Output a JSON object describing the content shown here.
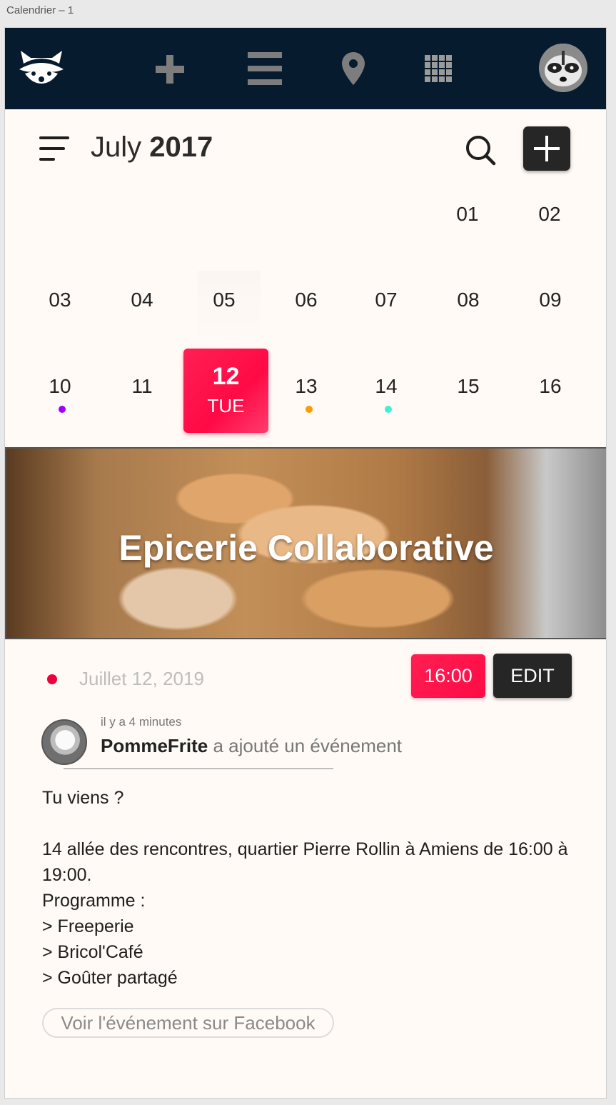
{
  "window": {
    "title": "Calendrier – 1"
  },
  "nav": {
    "icons": [
      "raccoon-logo",
      "plus-icon",
      "list-icon",
      "map-pin-icon",
      "grid-icon",
      "user-avatar"
    ]
  },
  "calendar": {
    "month": "July",
    "year": "2017",
    "weeks": [
      [
        "",
        "",
        "",
        "",
        "",
        "01",
        "02"
      ],
      [
        "03",
        "04",
        "05",
        "06",
        "07",
        "08",
        "09"
      ],
      [
        "10",
        "11",
        "12",
        "13",
        "14",
        "15",
        "16"
      ]
    ],
    "selected": {
      "day": "12",
      "weekday": "TUE"
    },
    "event_dots": {
      "10": "#a100ff",
      "13": "#ff9a00",
      "14": "#3ff0d6"
    }
  },
  "event": {
    "title": "Epicerie Collaborative",
    "date": "Juillet 12, 2019",
    "time": "16:00",
    "edit_label": "EDIT",
    "time_ago": "il y a 4 minutes",
    "user": "PommeFrite",
    "action": "a ajouté un événement",
    "description": "Tu viens ?\n\n14 allée des rencontres, quartier Pierre Rollin à Amiens de 16:00 à 19:00.\nProgramme :\n> Freeperie\n> Bricol'Café\n> Goûter partagé",
    "facebook_label": "Voir l'événement sur Facebook"
  },
  "colors": {
    "accent": "#ff0a45",
    "nav_bg": "#061c2e",
    "dark_button": "#262626"
  }
}
